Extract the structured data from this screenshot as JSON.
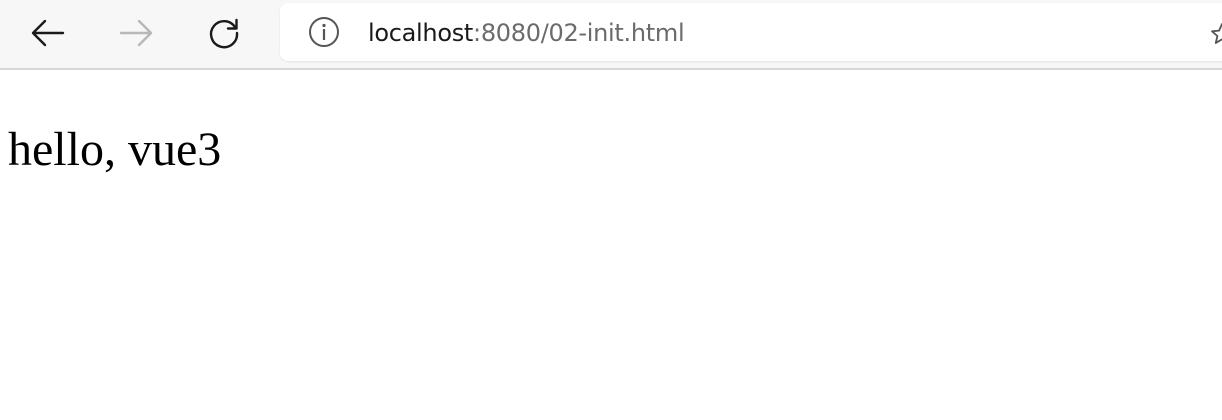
{
  "browser": {
    "icons": {
      "back": "back-arrow-icon",
      "forward": "forward-arrow-icon",
      "reload": "reload-icon",
      "site_info": "info-icon",
      "favorite": "favorite-star-icon"
    },
    "address_bar": {
      "host": "localhost",
      "path": ":8080/02-init.html"
    }
  },
  "page": {
    "text": "hello, vue3"
  },
  "colors": {
    "toolbar_bg": "#f7f7f7",
    "icon_active": "#1a1a1a",
    "icon_disabled": "#b8b8b8",
    "url_host": "#1a1a1a",
    "url_path": "#6b6b6b"
  }
}
